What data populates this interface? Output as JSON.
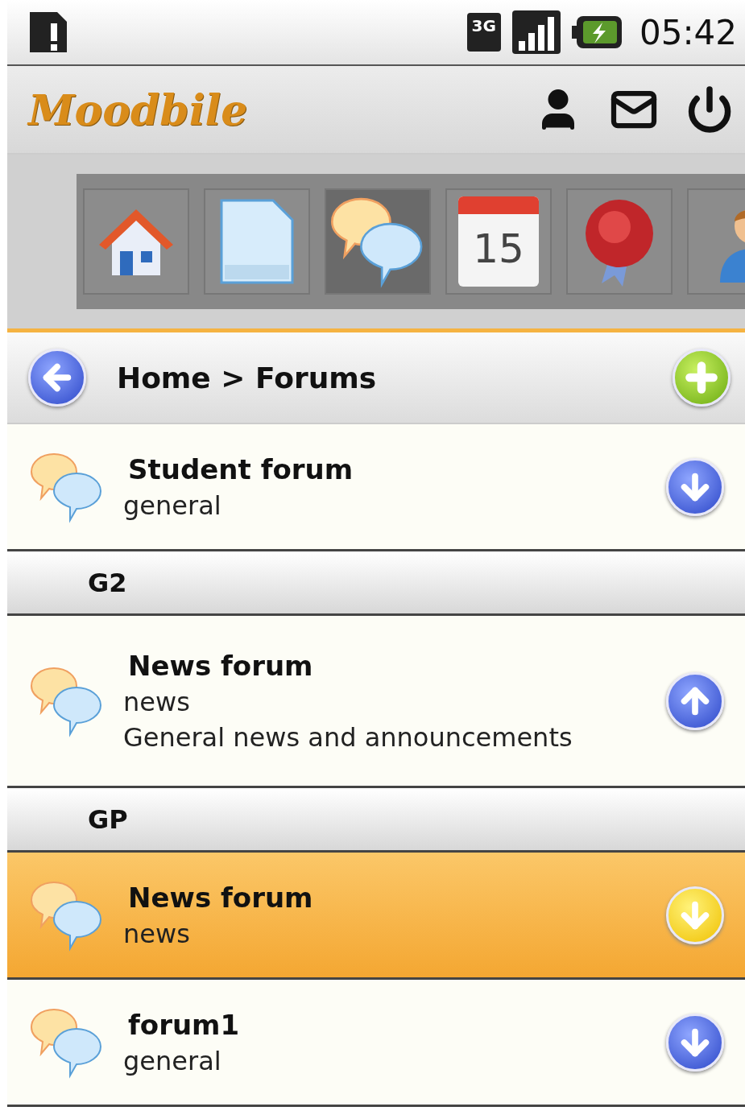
{
  "status_bar": {
    "network": "3G",
    "time": "05:42"
  },
  "header": {
    "logo": "Moodbile"
  },
  "toolbar": {
    "tiles": [
      {
        "kind": "home",
        "selected": false
      },
      {
        "kind": "document",
        "selected": false
      },
      {
        "kind": "forum",
        "selected": true
      },
      {
        "kind": "calendar",
        "label": "15",
        "selected": false
      },
      {
        "kind": "badge",
        "selected": false
      },
      {
        "kind": "user",
        "selected": false
      }
    ]
  },
  "breadcrumb": {
    "text": "Home > Forums"
  },
  "list": [
    {
      "kind": "forum",
      "title": "Student forum",
      "type": "general",
      "expanded": false,
      "selected": false
    },
    {
      "kind": "group",
      "title": "G2"
    },
    {
      "kind": "forum",
      "title": "News forum",
      "type": "news",
      "description": "General news and announcements",
      "expanded": true,
      "selected": false
    },
    {
      "kind": "group",
      "title": "GP"
    },
    {
      "kind": "forum",
      "title": "News forum",
      "type": "news",
      "expanded": false,
      "selected": true
    },
    {
      "kind": "forum",
      "title": "forum1",
      "type": "general",
      "expanded": false,
      "selected": false
    }
  ]
}
